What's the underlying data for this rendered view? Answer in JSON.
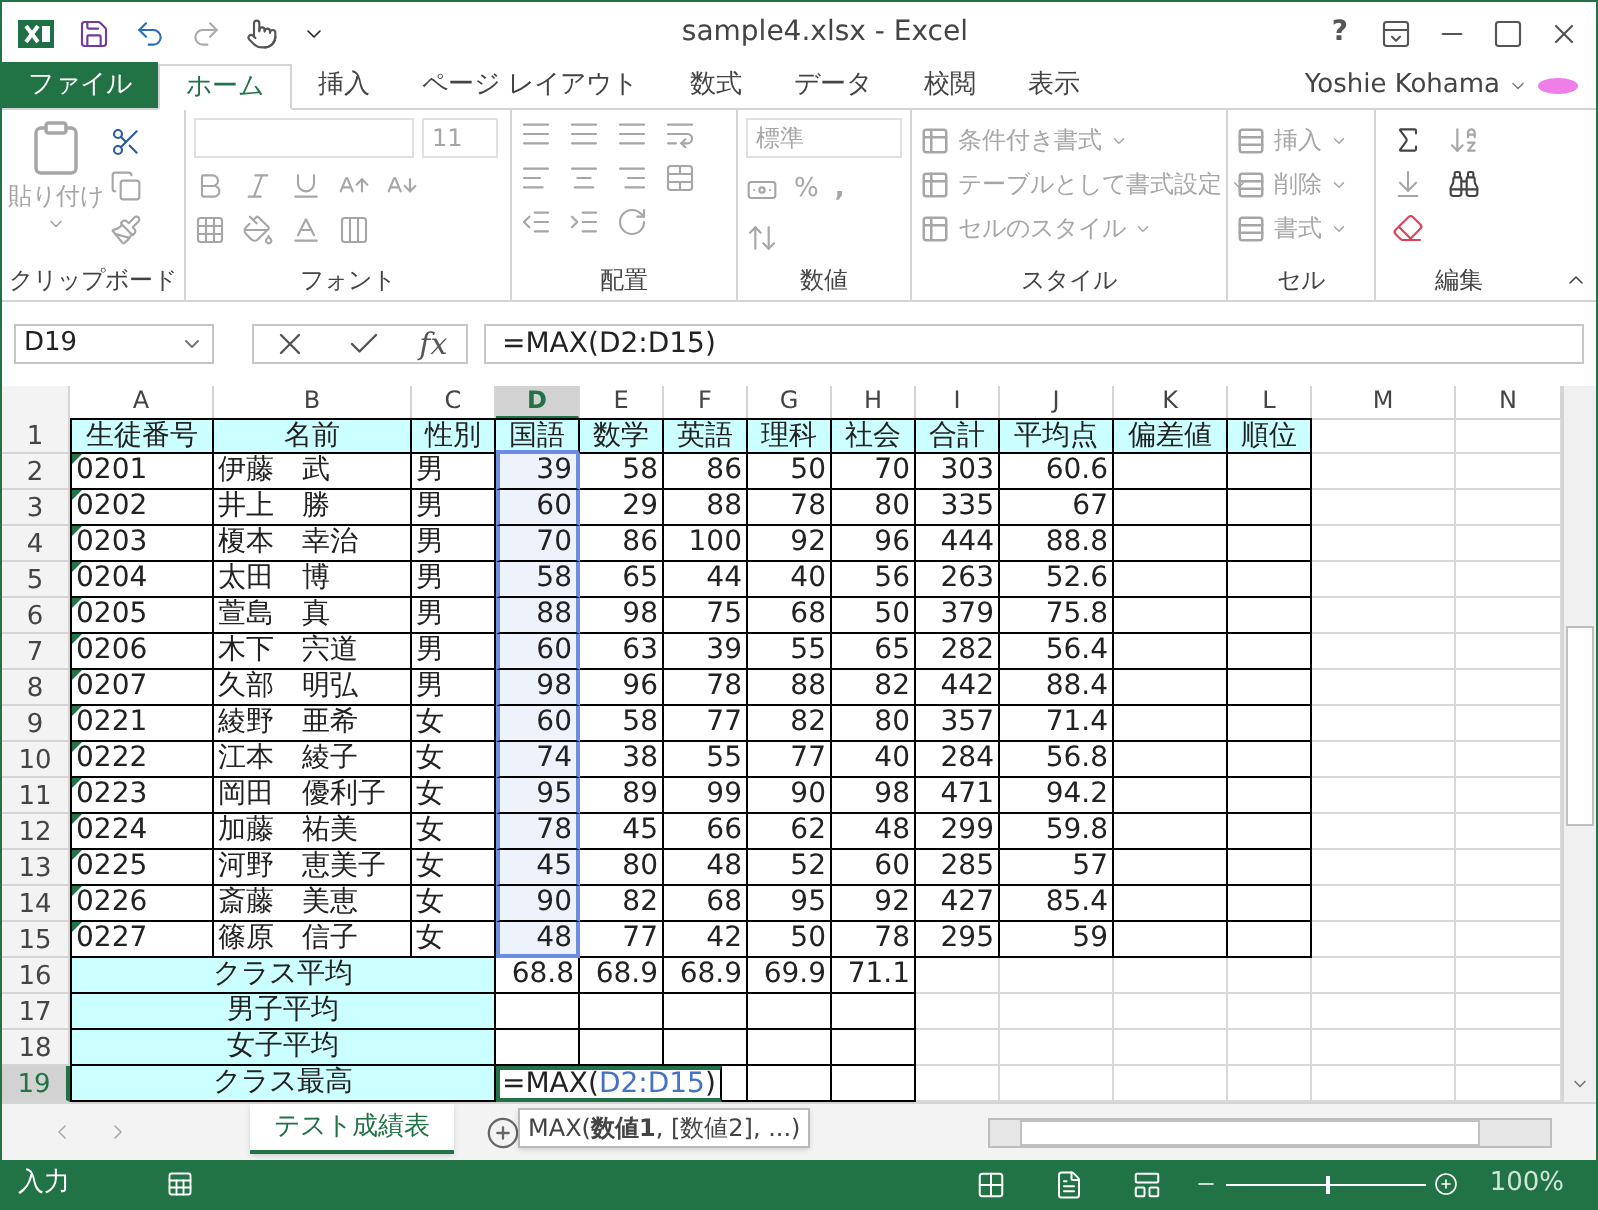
{
  "window": {
    "title": "sample4.xlsx - Excel",
    "help": "?"
  },
  "tabs": [
    {
      "label": "ファイル",
      "kind": "file",
      "selected": false
    },
    {
      "label": "ホーム",
      "kind": "tab",
      "selected": true
    },
    {
      "label": "挿入",
      "kind": "tab",
      "selected": false
    },
    {
      "label": "ページ レイアウト",
      "kind": "tab",
      "selected": false
    },
    {
      "label": "数式",
      "kind": "tab",
      "selected": false
    },
    {
      "label": "データ",
      "kind": "tab",
      "selected": false
    },
    {
      "label": "校閲",
      "kind": "tab",
      "selected": false
    },
    {
      "label": "表示",
      "kind": "tab",
      "selected": false
    }
  ],
  "user": "Yoshie Kohama",
  "ribbon": {
    "disabled": true,
    "clipboard": {
      "label": "クリップボード",
      "paste": "貼り付け"
    },
    "font": {
      "label": "フォント",
      "size": "11"
    },
    "alignment": {
      "label": "配置"
    },
    "number": {
      "label": "数値",
      "format": "標準",
      "percent": "%",
      "comma": ","
    },
    "styles": {
      "label": "スタイル",
      "items": [
        "条件付き書式",
        "テーブルとして書式設定",
        "セルのスタイル"
      ]
    },
    "cells": {
      "label": "セル",
      "items": [
        "挿入",
        "削除",
        "書式"
      ]
    },
    "editing": {
      "label": "編集"
    }
  },
  "formula_bar": {
    "name_box": "D19",
    "function_label": "fx",
    "formula": "=MAX(D2:D15)"
  },
  "columns": [
    {
      "label": "A",
      "selected": false
    },
    {
      "label": "B",
      "selected": false
    },
    {
      "label": "C",
      "selected": false
    },
    {
      "label": "D",
      "selected": true
    },
    {
      "label": "E",
      "selected": false
    },
    {
      "label": "F",
      "selected": false
    },
    {
      "label": "G",
      "selected": false
    },
    {
      "label": "H",
      "selected": false
    },
    {
      "label": "I",
      "selected": false
    },
    {
      "label": "J",
      "selected": false
    },
    {
      "label": "K",
      "selected": false
    },
    {
      "label": "L",
      "selected": false
    },
    {
      "label": "M",
      "selected": false
    },
    {
      "label": "N",
      "selected": false
    }
  ],
  "row_headers": [
    {
      "label": "1",
      "selected": false
    },
    {
      "label": "2",
      "selected": false
    },
    {
      "label": "3",
      "selected": false
    },
    {
      "label": "4",
      "selected": false
    },
    {
      "label": "5",
      "selected": false
    },
    {
      "label": "6",
      "selected": false
    },
    {
      "label": "7",
      "selected": false
    },
    {
      "label": "8",
      "selected": false
    },
    {
      "label": "9",
      "selected": false
    },
    {
      "label": "10",
      "selected": false
    },
    {
      "label": "11",
      "selected": false
    },
    {
      "label": "12",
      "selected": false
    },
    {
      "label": "13",
      "selected": false
    },
    {
      "label": "14",
      "selected": false
    },
    {
      "label": "15",
      "selected": false
    },
    {
      "label": "16",
      "selected": false
    },
    {
      "label": "17",
      "selected": false
    },
    {
      "label": "18",
      "selected": false
    },
    {
      "label": "19",
      "selected": true
    }
  ],
  "header_row": [
    "生徒番号",
    "名前",
    "性別",
    "国語",
    "数学",
    "英語",
    "理科",
    "社会",
    "合計",
    "平均点",
    "偏差値",
    "順位"
  ],
  "students": [
    {
      "id": "0201",
      "name": "伊藤　武",
      "gender": "男",
      "scores": [
        "39",
        "58",
        "86",
        "50",
        "70"
      ],
      "total": "303",
      "average": "60.6"
    },
    {
      "id": "0202",
      "name": "井上　勝",
      "gender": "男",
      "scores": [
        "60",
        "29",
        "88",
        "78",
        "80"
      ],
      "total": "335",
      "average": "67"
    },
    {
      "id": "0203",
      "name": "榎本　幸治",
      "gender": "男",
      "scores": [
        "70",
        "86",
        "100",
        "92",
        "96"
      ],
      "total": "444",
      "average": "88.8"
    },
    {
      "id": "0204",
      "name": "太田　博",
      "gender": "男",
      "scores": [
        "58",
        "65",
        "44",
        "40",
        "56"
      ],
      "total": "263",
      "average": "52.6"
    },
    {
      "id": "0205",
      "name": "萱島　真",
      "gender": "男",
      "scores": [
        "88",
        "98",
        "75",
        "68",
        "50"
      ],
      "total": "379",
      "average": "75.8"
    },
    {
      "id": "0206",
      "name": "木下　宍道",
      "gender": "男",
      "scores": [
        "60",
        "63",
        "39",
        "55",
        "65"
      ],
      "total": "282",
      "average": "56.4"
    },
    {
      "id": "0207",
      "name": "久部　明弘",
      "gender": "男",
      "scores": [
        "98",
        "96",
        "78",
        "88",
        "82"
      ],
      "total": "442",
      "average": "88.4"
    },
    {
      "id": "0221",
      "name": "綾野　亜希",
      "gender": "女",
      "scores": [
        "60",
        "58",
        "77",
        "82",
        "80"
      ],
      "total": "357",
      "average": "71.4"
    },
    {
      "id": "0222",
      "name": "江本　綾子",
      "gender": "女",
      "scores": [
        "74",
        "38",
        "55",
        "77",
        "40"
      ],
      "total": "284",
      "average": "56.8"
    },
    {
      "id": "0223",
      "name": "岡田　優利子",
      "gender": "女",
      "scores": [
        "95",
        "89",
        "99",
        "90",
        "98"
      ],
      "total": "471",
      "average": "94.2"
    },
    {
      "id": "0224",
      "name": "加藤　祐美",
      "gender": "女",
      "scores": [
        "78",
        "45",
        "66",
        "62",
        "48"
      ],
      "total": "299",
      "average": "59.8"
    },
    {
      "id": "0225",
      "name": "河野　恵美子",
      "gender": "女",
      "scores": [
        "45",
        "80",
        "48",
        "52",
        "60"
      ],
      "total": "285",
      "average": "57"
    },
    {
      "id": "0226",
      "name": "斎藤　美恵",
      "gender": "女",
      "scores": [
        "90",
        "82",
        "68",
        "95",
        "92"
      ],
      "total": "427",
      "average": "85.4"
    },
    {
      "id": "0227",
      "name": "篠原　信子",
      "gender": "女",
      "scores": [
        "48",
        "77",
        "42",
        "50",
        "78"
      ],
      "total": "295",
      "average": "59"
    }
  ],
  "summary_rows": [
    {
      "label": "クラス平均",
      "values": [
        "68.8",
        "68.9",
        "68.9",
        "69.9",
        "71.1"
      ]
    },
    {
      "label": "男子平均"
    },
    {
      "label": "女子平均"
    },
    {
      "label": "クラス最高",
      "editing": {
        "prefix": "=MAX(",
        "reference": "D2:D15",
        "suffix": ")"
      }
    }
  ],
  "tooltip": "MAX(**数値1**, [数値2], ...)",
  "sheet_tabs": [
    {
      "label": "テスト成績表",
      "selected": true
    }
  ],
  "status_bar": {
    "mode": "入力",
    "zoom": "100%",
    "zoom_slider": {
      "level": 0.5
    }
  }
}
